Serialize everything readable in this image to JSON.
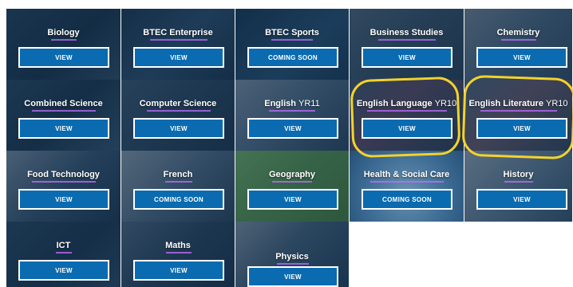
{
  "colors": {
    "button_blue": "#0a6bb1",
    "highlight_yellow": "#f4d22c",
    "overlay_navy": "#102a42"
  },
  "tiles": [
    {
      "title": "Biology",
      "suffix": "",
      "button": "VIEW",
      "bg": "linear-gradient(135deg,#27425e,#18314a 55%,#36526e)"
    },
    {
      "title": "BTEC Enterprise",
      "suffix": "",
      "button": "VIEW",
      "bg": "linear-gradient(135deg,#1d3653,#2f5173 50%,#1b3450)"
    },
    {
      "title": "BTEC Sports",
      "suffix": "",
      "button": "COMING SOON",
      "bg": "linear-gradient(135deg,#173653,#29557b 60%,#1a3a5a)"
    },
    {
      "title": "Business Studies",
      "suffix": "",
      "button": "VIEW",
      "bg": "linear-gradient(135deg,#5c7083,#3f5870 45%,#2b4258)"
    },
    {
      "title": "Chemistry",
      "suffix": "",
      "button": "VIEW",
      "bg": "linear-gradient(135deg,#8a97a6,#55708a 50%,#36516c)"
    },
    {
      "title": "Combined Science",
      "suffix": "",
      "button": "VIEW",
      "bg": "linear-gradient(135deg,#2c4966,#1a344d 50%,#3c5b79)"
    },
    {
      "title": "Computer Science",
      "suffix": "",
      "button": "VIEW",
      "bg": "linear-gradient(135deg,#445f7b,#2b4661 55%,#1d3650)"
    },
    {
      "title": "English ",
      "suffix": "YR11",
      "button": "VIEW",
      "bg": "linear-gradient(135deg,#93a4b6,#5a7592 50%,#2d4764)"
    },
    {
      "title": "English Language ",
      "suffix": "YR10",
      "button": "VIEW",
      "bg": "linear-gradient(135deg,#4a5e73,#6f4f6a 40%,#2a4058)"
    },
    {
      "title": "English Literature ",
      "suffix": "YR10",
      "button": "VIEW",
      "bg": "linear-gradient(135deg,#5b6f84,#7c5e70 45%,#33495f)"
    },
    {
      "title": "Food Technology",
      "suffix": "",
      "button": "VIEW",
      "bg": "linear-gradient(135deg,#8e9fb0,#3d5a78 50%,#1c3652)"
    },
    {
      "title": "French",
      "suffix": "",
      "button": "COMING SOON",
      "bg": "linear-gradient(135deg,#a6b3c0,#5d7691 50%,#2b4661)"
    },
    {
      "title": "Geography",
      "suffix": "",
      "button": "VIEW",
      "bg": "linear-gradient(135deg,#4f7f5a,#3c6b4c 45%,#2f5a3f)"
    },
    {
      "title": "Health & Social Care",
      "suffix": "",
      "button": "COMING SOON",
      "bg": "radial-gradient(circle at 50% 60%,#8ab4d6,#4f84b1 55%,#2d5d89)"
    },
    {
      "title": "History",
      "suffix": "",
      "button": "VIEW",
      "bg": "linear-gradient(135deg,#b3bfca,#7893ac 45%,#3e5a76)"
    },
    {
      "title": "ICT",
      "suffix": "",
      "button": "VIEW",
      "bg": "linear-gradient(135deg,#2b4865,#1c3550 55%,#2f4d6b)"
    },
    {
      "title": "Maths",
      "suffix": "",
      "button": "VIEW",
      "bg": "linear-gradient(135deg,#5a718a,#2d4661 50%,#1b334d)"
    },
    {
      "title": "Physics",
      "suffix": "",
      "button": "VIEW",
      "bg": "linear-gradient(135deg,#9aa8b6,#4c6883 45%,#23405e)"
    }
  ]
}
